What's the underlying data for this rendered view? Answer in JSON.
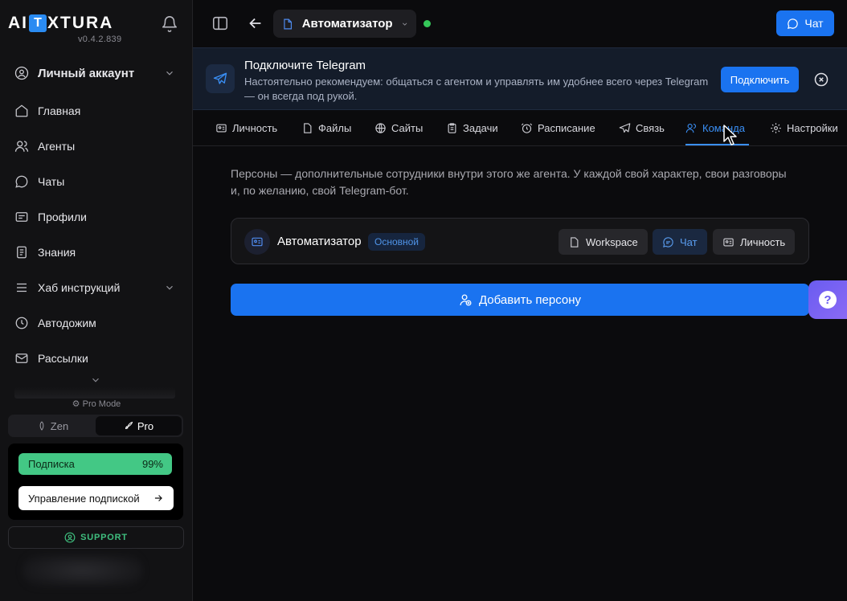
{
  "sidebar": {
    "logo_part1": "AI",
    "logo_letter": "T",
    "logo_part2": "XTURA",
    "version": "v0.4.2.839",
    "account_label": "Личный аккаунт",
    "items": [
      {
        "label": "Главная",
        "icon": "home-icon"
      },
      {
        "label": "Агенты",
        "icon": "users-icon"
      },
      {
        "label": "Чаты",
        "icon": "chat-icon"
      },
      {
        "label": "Профили",
        "icon": "profile-card-icon"
      },
      {
        "label": "Знания",
        "icon": "document-icon"
      },
      {
        "label": "Хаб инструкций",
        "icon": "hub-icon"
      },
      {
        "label": "Автодожим",
        "icon": "clock-icon"
      },
      {
        "label": "Рассылки",
        "icon": "mail-icon"
      }
    ],
    "pro_mode_label": "Pro Mode",
    "modes": {
      "zen": "Zen",
      "pro": "Pro",
      "active": "Pro"
    },
    "subscription": {
      "label": "Подписка",
      "percent": "99%",
      "manage_label": "Управление подпиской"
    },
    "support_label": "SUPPORT"
  },
  "topbar": {
    "agent_name": "Автоматизатор",
    "status": "online",
    "chat_button": "Чат"
  },
  "banner": {
    "title": "Подключите Telegram",
    "text": "Настоятельно рекомендуем: общаться с агентом и управлять им удобнее всего через Telegram — он всегда под рукой.",
    "connect_button": "Подключить"
  },
  "tabs": [
    {
      "label": "Личность",
      "icon": "id-card-icon"
    },
    {
      "label": "Файлы",
      "icon": "file-icon"
    },
    {
      "label": "Сайты",
      "icon": "globe-icon"
    },
    {
      "label": "Задачи",
      "icon": "clipboard-icon"
    },
    {
      "label": "Расписание",
      "icon": "alarm-icon"
    },
    {
      "label": "Связь",
      "icon": "send-icon"
    },
    {
      "label": "Команда",
      "icon": "team-icon",
      "active": true
    },
    {
      "label": "Настройки",
      "icon": "gear-icon"
    }
  ],
  "main": {
    "description": "Персоны — дополнительные сотрудники внутри этого же агента. У каждой свой характер, свои разговоры и, по желанию, свой Telegram-бот.",
    "persona": {
      "name": "Автоматизатор",
      "badge": "Основной",
      "buttons": {
        "workspace": "Workspace",
        "chat": "Чат",
        "personality": "Личность"
      }
    },
    "add_persona_button": "Добавить персону"
  },
  "colors": {
    "accent": "#1a73f0",
    "subscription_green": "#43c885",
    "online": "#35c759"
  }
}
